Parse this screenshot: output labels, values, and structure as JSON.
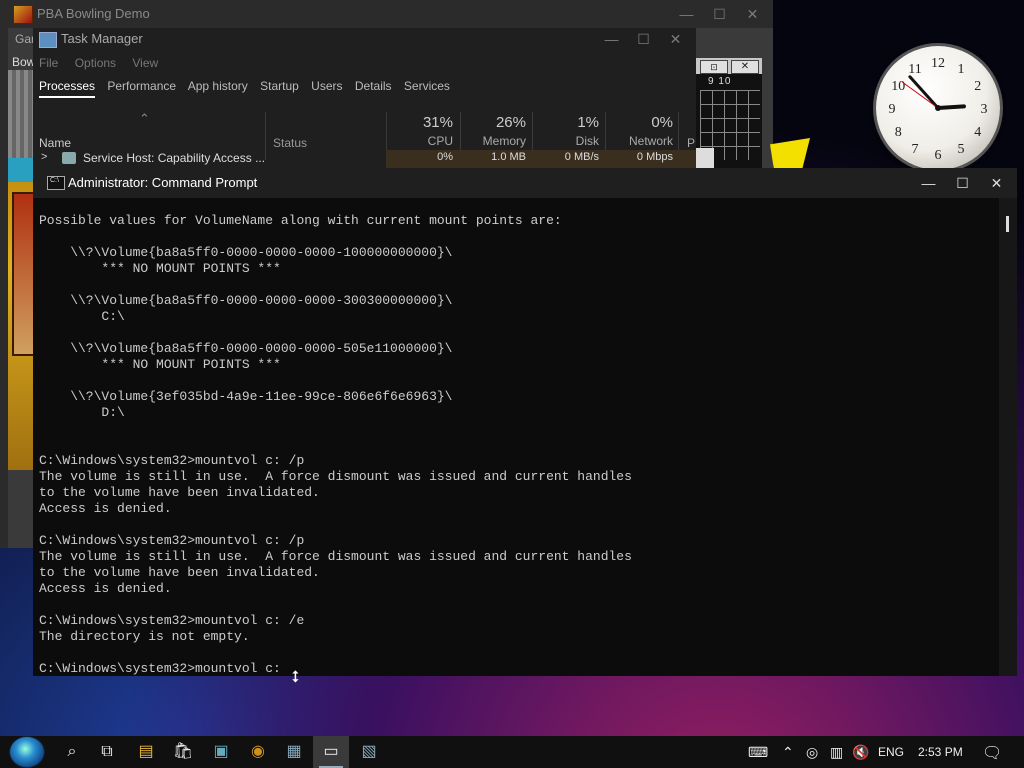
{
  "bowling": {
    "title": "PBA Bowling Demo",
    "menu_fragment": "Gar",
    "menu_fragment2": "Bow",
    "score_buttons": [
      "⊡",
      "✕"
    ],
    "score_numbers": "9  10"
  },
  "task_manager": {
    "title": "Task Manager",
    "menus": [
      "File",
      "Options",
      "View"
    ],
    "tabs": [
      "Processes",
      "Performance",
      "App history",
      "Startup",
      "Users",
      "Details",
      "Services"
    ],
    "columns": {
      "name": "Name",
      "status": "Status",
      "cpu": {
        "pct": "31%",
        "label": "CPU"
      },
      "memory": {
        "pct": "26%",
        "label": "Memory"
      },
      "disk": {
        "pct": "1%",
        "label": "Disk"
      },
      "network": {
        "pct": "0%",
        "label": "Network"
      },
      "power": "P"
    },
    "row": {
      "name": "Service Host: Capability Access ...",
      "cpu": "0%",
      "memory": "1.0 MB",
      "disk": "0 MB/s",
      "network": "0 Mbps"
    }
  },
  "clock": {
    "numbers": [
      "12",
      "1",
      "2",
      "3",
      "4",
      "5",
      "6",
      "7",
      "8",
      "9",
      "10",
      "11"
    ],
    "hour": 2,
    "minute": 53,
    "second": 51
  },
  "cmd": {
    "title": "Administrator: Command Prompt",
    "output": "Possible values for VolumeName along with current mount points are:\n\n    \\\\?\\Volume{ba8a5ff0-0000-0000-0000-100000000000}\\\n        *** NO MOUNT POINTS ***\n\n    \\\\?\\Volume{ba8a5ff0-0000-0000-0000-300300000000}\\\n        C:\\\n\n    \\\\?\\Volume{ba8a5ff0-0000-0000-0000-505e11000000}\\\n        *** NO MOUNT POINTS ***\n\n    \\\\?\\Volume{3ef035bd-4a9e-11ee-99ce-806e6f6e6963}\\\n        D:\\\n\n\nC:\\Windows\\system32>mountvol c: /p\nThe volume is still in use.  A force dismount was issued and current handles\nto the volume have been invalidated.\nAccess is denied.\n\nC:\\Windows\\system32>mountvol c: /p\nThe volume is still in use.  A force dismount was issued and current handles\nto the volume have been invalidated.\nAccess is denied.\n\nC:\\Windows\\system32>mountvol c: /e\nThe directory is not empty.\n\nC:\\Windows\\system32>mountvol c:"
  },
  "taskbar": {
    "language": "ENG",
    "time": "2:53 PM"
  },
  "window_controls": {
    "minimize": "—",
    "maximize": "☐",
    "close": "✕"
  }
}
